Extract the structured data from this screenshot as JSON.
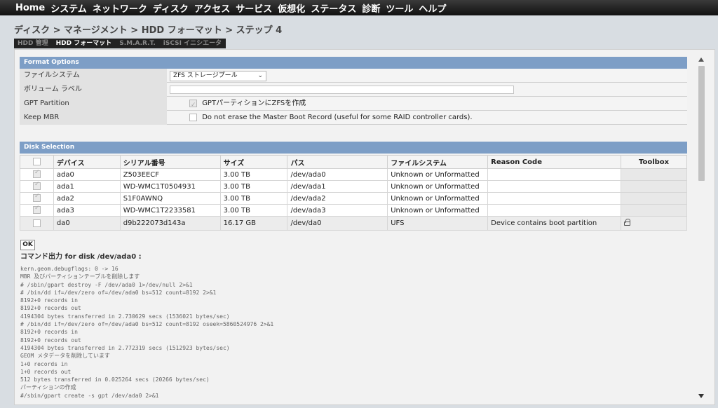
{
  "nav": {
    "items": [
      "Home",
      "システム",
      "ネットワーク",
      "ディスク",
      "アクセス",
      "サービス",
      "仮想化",
      "ステータス",
      "診断",
      "ツール",
      "ヘルプ"
    ]
  },
  "breadcrumb": "ディスク > マネージメント > HDD フォーマット > ステップ 4",
  "tabs": [
    {
      "label": "HDD 管理",
      "active": false
    },
    {
      "label": "HDD フォーマット",
      "active": true
    },
    {
      "label": "S.M.A.R.T.",
      "active": false
    },
    {
      "label": "iSCSI イニシエータ",
      "active": false
    }
  ],
  "format_options": {
    "header": "Format Options",
    "filesystem_label": "ファイルシステム",
    "filesystem_value": "ZFS ストレージプール",
    "volume_label_label": "ボリューム ラベル",
    "volume_label_value": "",
    "gpt_label": "GPT Partition",
    "gpt_text": "GPTパーティションにZFSを作成",
    "gpt_checked": true,
    "mbr_label": "Keep MBR",
    "mbr_text": "Do not erase the Master Boot Record (useful for some RAID controller cards).",
    "mbr_checked": false
  },
  "disk_selection": {
    "header": "Disk Selection",
    "columns": [
      "",
      "デバイス",
      "シリアル番号",
      "サイズ",
      "パス",
      "ファイルシステム",
      "Reason Code",
      "Toolbox"
    ],
    "rows": [
      {
        "checked": true,
        "device": "ada0",
        "serial": "Z503EECF",
        "size": "3.00 TB",
        "path": "/dev/ada0",
        "fs": "Unknown or Unformatted",
        "reason": "",
        "locked": false
      },
      {
        "checked": true,
        "device": "ada1",
        "serial": "WD-WMC1T0504931",
        "size": "3.00 TB",
        "path": "/dev/ada1",
        "fs": "Unknown or Unformatted",
        "reason": "",
        "locked": false
      },
      {
        "checked": true,
        "device": "ada2",
        "serial": "S1F0AWNQ",
        "size": "3.00 TB",
        "path": "/dev/ada2",
        "fs": "Unknown or Unformatted",
        "reason": "",
        "locked": false
      },
      {
        "checked": true,
        "device": "ada3",
        "serial": "WD-WMC1T2233581",
        "size": "3.00 TB",
        "path": "/dev/ada3",
        "fs": "Unknown or Unformatted",
        "reason": "",
        "locked": false
      },
      {
        "checked": false,
        "device": "da0",
        "serial": "d9b222073d143a",
        "size": "16.17 GB",
        "path": "/dev/da0",
        "fs": "UFS",
        "reason": "Device contains boot partition",
        "locked": true
      }
    ]
  },
  "ok_label": "OK",
  "command_output": {
    "title": "コマンド出力 for disk /dev/ada0 :",
    "lines": [
      "kern.geom.debugflags: 0 -> 16",
      "MBR 及びパーティションテーブルを削除します",
      "# /sbin/gpart destroy -F /dev/ada0 1>/dev/null 2>&1",
      "# /bin/dd if=/dev/zero of=/dev/ada0 bs=512 count=8192 2>&1",
      "8192+0 records in",
      "8192+0 records out",
      "4194304 bytes transferred in 2.730629 secs (1536021 bytes/sec)",
      "# /bin/dd if=/dev/zero of=/dev/ada0 bs=512 count=8192 oseek=5860524976 2>&1",
      "8192+0 records in",
      "8192+0 records out",
      "4194304 bytes transferred in 2.772319 secs (1512923 bytes/sec)",
      "GEOM メタデータを削除しています",
      "1+0 records in",
      "1+0 records out",
      "512 bytes transferred in 0.025264 secs (20266 bytes/sec)",
      "パーティションの作成",
      "#/sbin/gpart create -s gpt /dev/ada0 2>&1"
    ]
  }
}
